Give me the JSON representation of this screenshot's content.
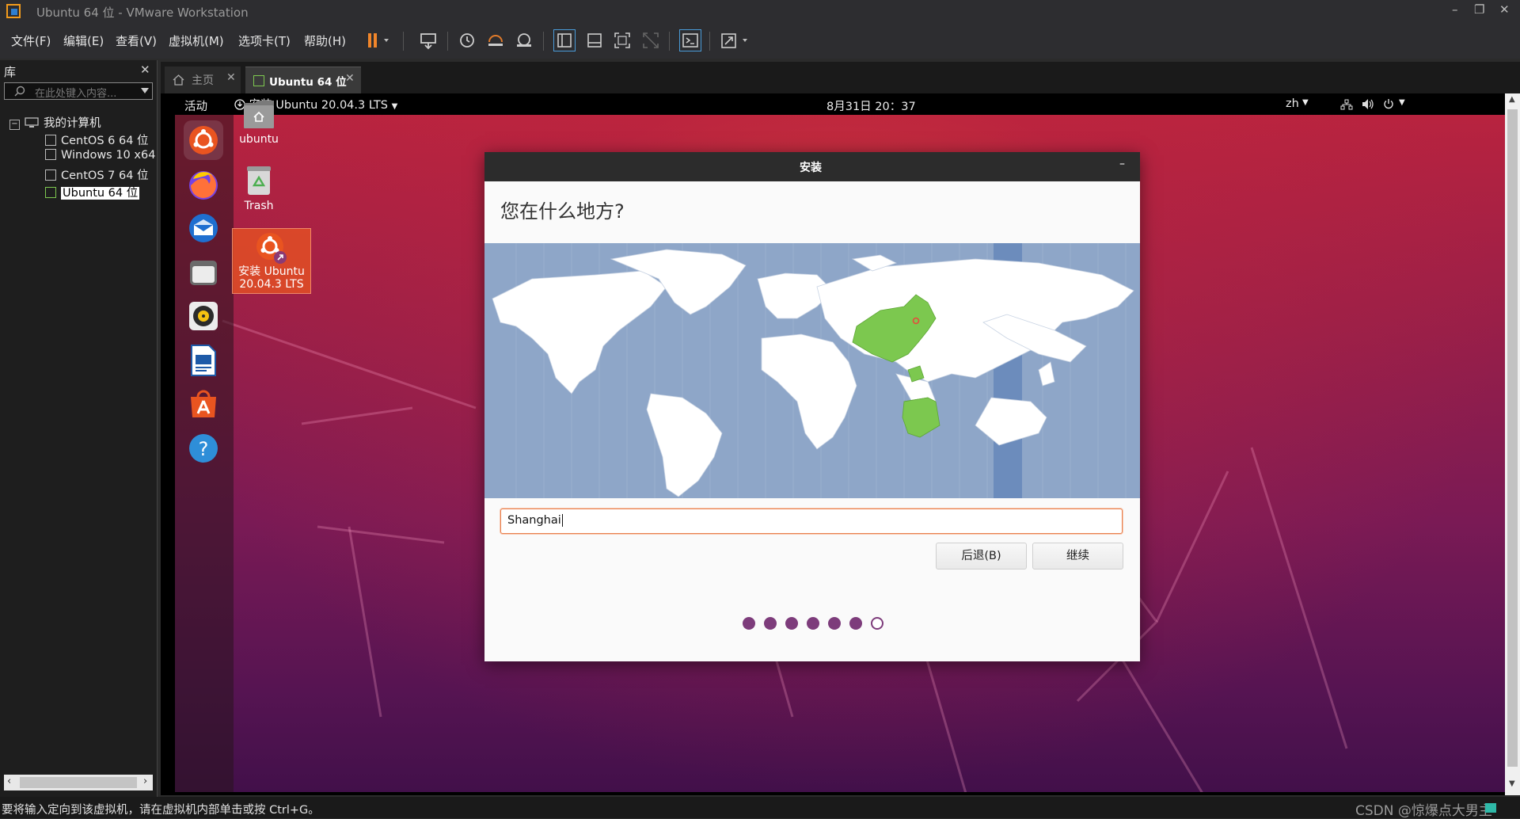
{
  "window": {
    "title": "Ubuntu 64 位 - VMware Workstation",
    "controls": [
      "–",
      "❐",
      "✕"
    ]
  },
  "menu": {
    "items": [
      "文件(F)",
      "编辑(E)",
      "查看(V)",
      "虚拟机(M)",
      "选项卡(T)",
      "帮助(H)"
    ]
  },
  "library": {
    "title": "库",
    "close": "✕",
    "search_placeholder": "在此处键入内容...",
    "root": "我的计算机",
    "vms": [
      "CentOS 6 64 位",
      "Windows 10 x64",
      "CentOS 7 64 位",
      "Ubuntu 64 位"
    ],
    "selected_vm": "Ubuntu 64 位"
  },
  "tabs": [
    {
      "label": "主页",
      "active": false
    },
    {
      "label": "Ubuntu 64 位",
      "active": true
    }
  ],
  "guest_topbar": {
    "activities": "活动",
    "app": "安装 Ubuntu 20.04.3 LTS",
    "clock": "8月31日  20：37",
    "lang": "zh"
  },
  "desktop": {
    "icons": [
      {
        "label": "ubuntu"
      },
      {
        "label": "Trash"
      },
      {
        "label": "安装 Ubuntu 20.04.3 LTS",
        "line1": "安装 Ubuntu",
        "line2": "20.04.3 LTS"
      }
    ]
  },
  "dock": {
    "apps": [
      "ubuntu-installer-icon",
      "firefox-icon",
      "thunderbird-icon",
      "files-icon",
      "rhythmbox-icon",
      "libreoffice-writer-icon",
      "software-center-icon",
      "help-icon"
    ]
  },
  "dialog": {
    "title": "安装",
    "minimize": "–",
    "heading": "您在什么地方?",
    "timezone_value": "Shanghai",
    "back_label": "后退(B)",
    "continue_label": "继续",
    "progress": {
      "total": 7,
      "completed": 6
    }
  },
  "status": {
    "message": "要将输入定向到该虚拟机，请在虚拟机内部单击或按 Ctrl+G。",
    "watermark": "CSDN @惊爆点大男主"
  },
  "colors": {
    "accent": "#e9814f",
    "progress": "#7d3c7b",
    "land": "#ffffff",
    "ocean": "#8ea6c8",
    "selected_zone": "#7cc84f"
  }
}
